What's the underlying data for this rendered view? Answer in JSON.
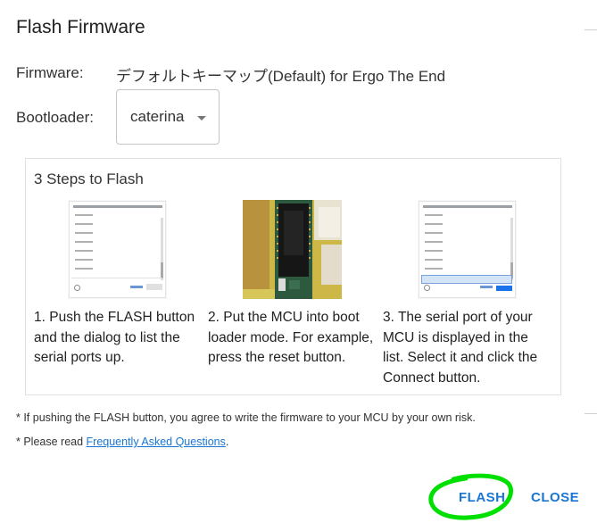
{
  "dialog": {
    "title": "Flash Firmware",
    "firmware_label": "Firmware:",
    "firmware_value": "デフォルトキーマップ(Default) for Ergo The End",
    "bootloader_label": "Bootloader:",
    "bootloader_value": "caterina"
  },
  "steps": {
    "title": "3 Steps to Flash",
    "items": [
      {
        "text": "1. Push the FLASH button\nand the dialog to list the\nserial ports up.",
        "image": "serial-port-dialog-screenshot"
      },
      {
        "text": "2. Put the MCU into boot\nloader mode. For example,\npress the reset button.",
        "image": "mcu-board-photo"
      },
      {
        "text": "3. The serial port of your\nMCU is displayed in the\nlist. Select it and click the\nConnect button.",
        "image": "serial-port-selected-screenshot"
      }
    ]
  },
  "notes": {
    "risk": "* If pushing the FLASH button, you agree to write the firmware to your MCU by your own risk.",
    "faq_prefix": "* Please read ",
    "faq_link": "Frequently Asked Questions",
    "faq_suffix": "."
  },
  "actions": {
    "flash_label": "FLASH",
    "close_label": "CLOSE"
  },
  "colors": {
    "accent": "#1976d2",
    "annotation": "#00e000"
  }
}
